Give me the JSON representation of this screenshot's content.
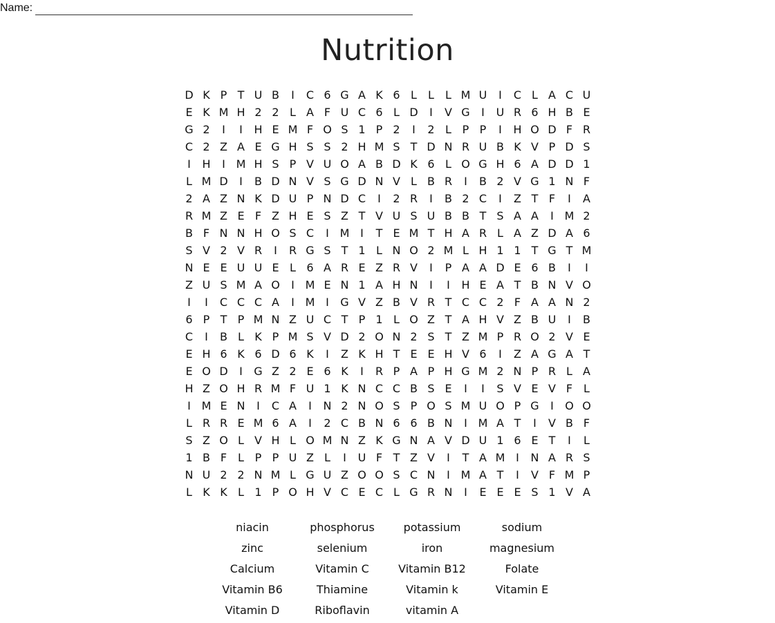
{
  "header": {
    "name_label": "Name:"
  },
  "title": "Nutrition",
  "grid": {
    "rows": [
      "DKPTUBIC6GAK6LLLMUICLACU",
      "EKMH22LAFUC6LDIVGIUR6HBE",
      "G2IIHEMFOS1P2I2LPPIHODFR",
      "C2ZAEGHSS2HMSTDNRUBKVPDS",
      "IHIMHSPVUOABDK6LOGH6ADD1",
      "LMDIBDNVSGDNVLBRIB2VG1NF",
      "2AZNKDUPNDCI2RIB2CIZTFIA",
      "RMZEFZHESZTVUSUBBTSAAIM2",
      "BFNNHOSCIMITEMTHARLAZDA6",
      "SV2VRIRGST1LNO2MLH11TGTM",
      "NEEUUEL6AREZRVIPAADE6BII",
      "ZUSMAOIMEN1AHNIIHEATBNVO",
      "IICCCAIMIGVZBVRTCC2FAAN2",
      "6PTPMNZUCTP1LOZTAHVZBUIB",
      "CIBLKPMSVD2ON2STZMPRO2VE",
      "EH6K6D6KIZKHTEEHV6IZAGAT",
      "EODIGZ2E6KIRPAPHGM2NPRLA",
      "HZOHRMFU1KNCCBSEIISVEVFL",
      "IMENICAIN2NOSPOSMUOPGIOO",
      "LRREM6AI2CBN66BNIMATIVBF",
      "SZOLVHLOMNZKGNAVDU16ETIL",
      "1BFLPPUZLIUFTZVITAMINARS",
      "NU22NMLGUZOOSCNIMATIVFMP",
      "LKKL1POHVCECLGRNIEEES1VA"
    ]
  },
  "word_bank": {
    "words": [
      "niacin",
      "phosphorus",
      "potassium",
      "sodium",
      "zinc",
      "selenium",
      "iron",
      "magnesium",
      "Calcium",
      "Vitamin C",
      "Vitamin B12",
      "Folate",
      "Vitamin B6",
      "Thiamine",
      "Vitamin k",
      "Vitamin E",
      "Vitamin D",
      "Riboflavin",
      "vitamin A"
    ]
  }
}
